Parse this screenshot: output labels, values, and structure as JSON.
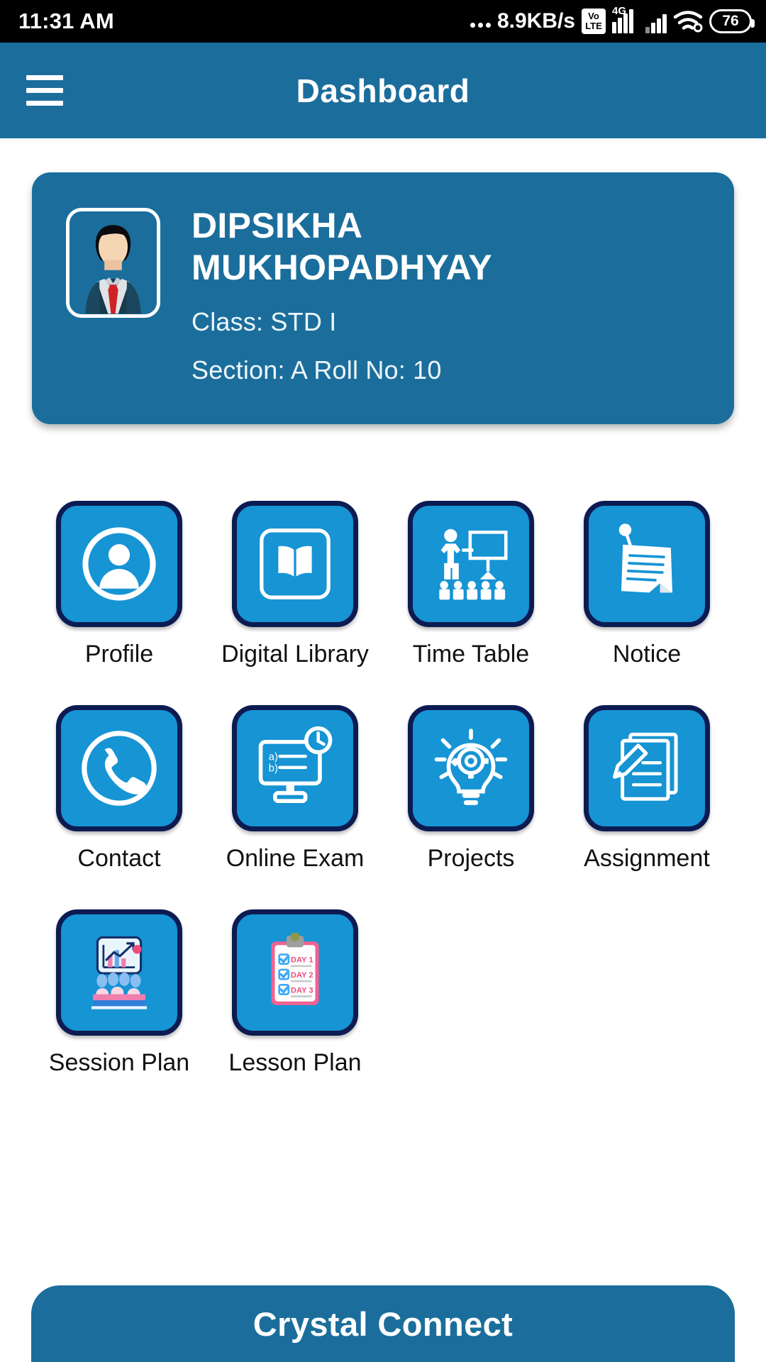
{
  "status_bar": {
    "time": "11:31 AM",
    "network_speed": "8.9KB/s",
    "volte_top": "Vo",
    "volte_bottom": "LTE",
    "network_type": "4G",
    "battery": "76"
  },
  "app_bar": {
    "title": "Dashboard",
    "menu_icon": "hamburger-menu-icon"
  },
  "profile": {
    "name": "DIPSIKHA MUKHOPADHYAY",
    "class_line": "Class: STD I",
    "section_line": "Section: A Roll No: 10",
    "avatar_icon": "user-avatar-photo"
  },
  "grid": {
    "items": [
      {
        "label": "Profile",
        "icon": "person-circle-icon"
      },
      {
        "label": "Digital Library",
        "icon": "open-book-icon"
      },
      {
        "label": "Time Table",
        "icon": "teacher-board-class-icon"
      },
      {
        "label": "Notice",
        "icon": "notice-pin-paper-icon"
      },
      {
        "label": "Contact",
        "icon": "phone-circle-icon"
      },
      {
        "label": "Online Exam",
        "icon": "computer-monitor-clock-icon"
      },
      {
        "label": "Projects",
        "icon": "lightbulb-gear-idea-icon"
      },
      {
        "label": "Assignment",
        "icon": "documents-pencil-icon"
      },
      {
        "label": "Session Plan",
        "icon": "presentation-audience-icon"
      },
      {
        "label": "Lesson Plan",
        "icon": "clipboard-days-checklist-icon"
      }
    ]
  },
  "bottom_bar": {
    "label": "Crystal Connect"
  },
  "colors": {
    "brand_dark_blue": "#1B6E9C",
    "tile_blue": "#1694D4",
    "tile_border_navy": "#0D1B52",
    "status_bar_black": "#000000",
    "page_background": "#FFFFFF"
  },
  "lesson_plan_icon_text": {
    "day1": "DAY 1",
    "day2": "DAY 2",
    "day3": "DAY 3"
  }
}
